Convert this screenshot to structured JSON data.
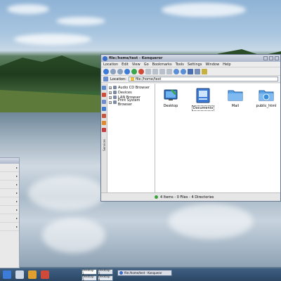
{
  "window": {
    "title": "file:/home/test - Konqueror",
    "menu": [
      "Location",
      "Edit",
      "View",
      "Go",
      "Bookmarks",
      "Tools",
      "Settings",
      "Window",
      "Help"
    ],
    "location_label": "Location:",
    "location_value": "file:/home/test"
  },
  "sidebar": {
    "vertical_label": "Services",
    "items": [
      {
        "label": "Audio CD Browser"
      },
      {
        "label": "Devices"
      },
      {
        "label": "LAN Browser"
      },
      {
        "label": "Print System Browser"
      }
    ]
  },
  "files": [
    {
      "label": "Desktop",
      "icon": "desktop-folder-icon"
    },
    {
      "label": "Documents",
      "icon": "documents-folder-icon",
      "selected": true
    },
    {
      "label": "Mail",
      "icon": "mail-folder-icon"
    },
    {
      "label": "public_html",
      "icon": "public-html-folder-icon"
    }
  ],
  "status": {
    "text": "4 Items - 0 Files - 4 Directories"
  },
  "taskbar": {
    "desktops": [
      "Desktop 1",
      "Desktop 2",
      "Desktop 3",
      "Desktop 4"
    ],
    "task_label": "file:/home/test - Konqueror"
  },
  "colors": {
    "accent": "#3b6dc6",
    "folder": "#5aa5e8",
    "taskbar": "#2b4765"
  }
}
